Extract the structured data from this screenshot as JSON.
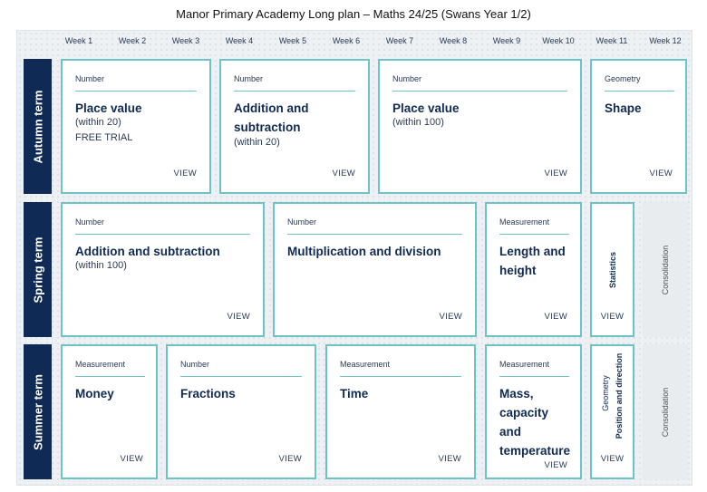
{
  "title": "Manor Primary Academy Long plan – Maths 24/25 (Swans Year 1/2)",
  "weeks": [
    "Week 1",
    "Week 2",
    "Week 3",
    "Week 4",
    "Week 5",
    "Week 6",
    "Week 7",
    "Week 8",
    "Week 9",
    "Week 10",
    "Week 11",
    "Week 12"
  ],
  "terms": {
    "autumn": "Autumn term",
    "spring": "Spring term",
    "summer": "Summer term"
  },
  "view_label": "VIEW",
  "autumn": [
    {
      "category": "Number",
      "heading": "Place value",
      "sub1": "(within 20)",
      "sub2": "FREE TRIAL"
    },
    {
      "category": "Number",
      "heading1": "Addition and",
      "heading2": "subtraction",
      "sub1": "(within 20)"
    },
    {
      "category": "Number",
      "heading": "Place value",
      "sub1": "(within 100)"
    },
    {
      "category": "Geometry",
      "heading": "Shape"
    }
  ],
  "spring": [
    {
      "category": "Number",
      "heading": "Addition and subtraction",
      "sub1": "(within 100)"
    },
    {
      "category": "Number",
      "heading": "Multiplication and division"
    },
    {
      "category": "Measurement",
      "heading1": "Length and",
      "heading2": "height"
    },
    {
      "heading": "Statistics"
    },
    {
      "heading": "Consolidation"
    }
  ],
  "summer": [
    {
      "category": "Measurement",
      "heading": "Money"
    },
    {
      "category": "Number",
      "heading": "Fractions"
    },
    {
      "category": "Measurement",
      "heading": "Time"
    },
    {
      "category": "Measurement",
      "heading1": "Mass,",
      "heading2": "capacity",
      "heading3": "and",
      "heading4": "temperature"
    },
    {
      "category": "Geometry",
      "heading": "Position and direction"
    },
    {
      "heading": "Consolidation"
    }
  ]
}
